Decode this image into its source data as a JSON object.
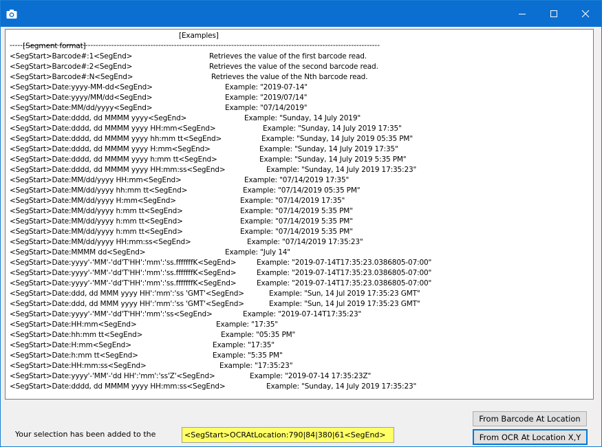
{
  "window": {
    "icon": "camera-icon",
    "controls": [
      "minimize-icon",
      "maximize-icon",
      "close-icon"
    ]
  },
  "list": {
    "header_format": "[Segment format]",
    "header_examples": "[Examples]",
    "separator": "----------------------------------------------------------------------------------------------------------------------------------------------",
    "rows": [
      {
        "fmt": "<SegStart>Barcode#:1<SegEnd>",
        "desc": "Retrieves the value of the first barcode read."
      },
      {
        "fmt": "<SegStart>Barcode#:2<SegEnd>",
        "desc": "Retrieves the value of the second barcode read."
      },
      {
        "fmt": "<SegStart>Barcode#:N<SegEnd>",
        "desc": "Retrieves the value of the Nth barcode read."
      },
      {
        "fmt": "<SegStart>Date:yyyy-MM-dd<SegEnd>",
        "desc": "Example: \"2019-07-14\""
      },
      {
        "fmt": "<SegStart>Date:yyyy/MM/dd<SegEnd>",
        "desc": "Example: \"2019/07/14\""
      },
      {
        "fmt": "<SegStart>Date:MM/dd/yyyy<SegEnd>",
        "desc": "Example: \"07/14/2019\""
      },
      {
        "fmt": "<SegStart>Date:dddd, dd MMMM yyyy<SegEnd>",
        "desc": "Example: \"Sunday, 14 July 2019\""
      },
      {
        "fmt": "<SegStart>Date:dddd, dd MMMM yyyy HH:mm<SegEnd>",
        "desc": "Example: \"Sunday, 14 July 2019 17:35\""
      },
      {
        "fmt": "<SegStart>Date:dddd, dd MMMM yyyy hh:mm tt<SegEnd>",
        "desc": "Example: \"Sunday, 14 July 2019 05:35 PM\""
      },
      {
        "fmt": "<SegStart>Date:dddd, dd MMMM yyyy H:mm<SegEnd>",
        "desc": "Example: \"Sunday, 14 July 2019 17:35\""
      },
      {
        "fmt": "<SegStart>Date:dddd, dd MMMM yyyy h:mm tt<SegEnd>",
        "desc": "Example: \"Sunday, 14 July 2019 5:35 PM\""
      },
      {
        "fmt": "<SegStart>Date:dddd, dd MMMM yyyy HH:mm:ss<SegEnd>",
        "desc": "Example: \"Sunday, 14 July 2019 17:35:23\""
      },
      {
        "fmt": "<SegStart>Date:MM/dd/yyyy HH:mm<SegEnd>",
        "desc": "Example: \"07/14/2019 17:35\""
      },
      {
        "fmt": "<SegStart>Date:MM/dd/yyyy hh:mm tt<SegEnd>",
        "desc": "Example: \"07/14/2019 05:35 PM\""
      },
      {
        "fmt": "<SegStart>Date:MM/dd/yyyy H:mm<SegEnd>",
        "desc": "Example: \"07/14/2019 17:35\""
      },
      {
        "fmt": "<SegStart>Date:MM/dd/yyyy h:mm tt<SegEnd>",
        "desc": "Example: \"07/14/2019 5:35 PM\""
      },
      {
        "fmt": "<SegStart>Date:MM/dd/yyyy h:mm tt<SegEnd>",
        "desc": "Example: \"07/14/2019 5:35 PM\""
      },
      {
        "fmt": "<SegStart>Date:MM/dd/yyyy h:mm tt<SegEnd>",
        "desc": "Example: \"07/14/2019 5:35 PM\""
      },
      {
        "fmt": "<SegStart>Date:MM/dd/yyyy HH:mm:ss<SegEnd>",
        "desc": "Example: \"07/14/2019 17:35:23\""
      },
      {
        "fmt": "<SegStart>Date:MMMM dd<SegEnd>",
        "desc": "Example: \"July 14\""
      },
      {
        "fmt": "<SegStart>Date:yyyy'-'MM'-'dd'T'HH':'mm':'ss.fffffffK<SegEnd>",
        "desc": "Example: \"2019-07-14T17:35:23.0386805-07:00\""
      },
      {
        "fmt": "<SegStart>Date:yyyy'-'MM'-'dd'T'HH':'mm':'ss.fffffffK<SegEnd>",
        "desc": "Example: \"2019-07-14T17:35:23.0386805-07:00\""
      },
      {
        "fmt": "<SegStart>Date:yyyy'-'MM'-'dd'T'HH':'mm':'ss.fffffffK<SegEnd>",
        "desc": "Example: \"2019-07-14T17:35:23.0386805-07:00\""
      },
      {
        "fmt": "<SegStart>Date:ddd, dd MMM yyyy HH':'mm':'ss 'GMT'<SegEnd>",
        "desc": "Example: \"Sun, 14 Jul 2019 17:35:23 GMT\""
      },
      {
        "fmt": "<SegStart>Date:ddd, dd MMM yyyy HH':'mm':'ss 'GMT'<SegEnd>",
        "desc": "Example: \"Sun, 14 Jul 2019 17:35:23 GMT\""
      },
      {
        "fmt": "<SegStart>Date:yyyy'-'MM'-'dd'T'HH':'mm':'ss<SegEnd>",
        "desc": "Example: \"2019-07-14T17:35:23\""
      },
      {
        "fmt": "<SegStart>Date:HH:mm<SegEnd>",
        "desc": "Example: \"17:35\""
      },
      {
        "fmt": "<SegStart>Date:hh:mm tt<SegEnd>",
        "desc": "Example: \"05:35 PM\""
      },
      {
        "fmt": "<SegStart>Date:H:mm<SegEnd>",
        "desc": "Example: \"17:35\""
      },
      {
        "fmt": "<SegStart>Date:h:mm tt<SegEnd>",
        "desc": "Example: \"5:35 PM\""
      },
      {
        "fmt": "<SegStart>Date:HH:mm:ss<SegEnd>",
        "desc": "Example: \"17:35:23\""
      },
      {
        "fmt": "<SegStart>Date:yyyy'-'MM'-'dd HH':'mm':'ss'Z'<SegEnd>",
        "desc": "Example: \"2019-07-14 17:35:23Z\""
      },
      {
        "fmt": "<SegStart>Date:dddd, dd MMMM yyyy HH:mm:ss<SegEnd>",
        "desc": "Example: \"Sunday, 14 July 2019 17:35:23\""
      }
    ]
  },
  "footer": {
    "status_text": "Your selection has been added to the",
    "selection_value": "<SegStart>OCRAtLocation:790|84|380|61<SegEnd>",
    "barcode_button": "From Barcode At Location",
    "ocr_button": "From OCR At Location X,Y"
  }
}
